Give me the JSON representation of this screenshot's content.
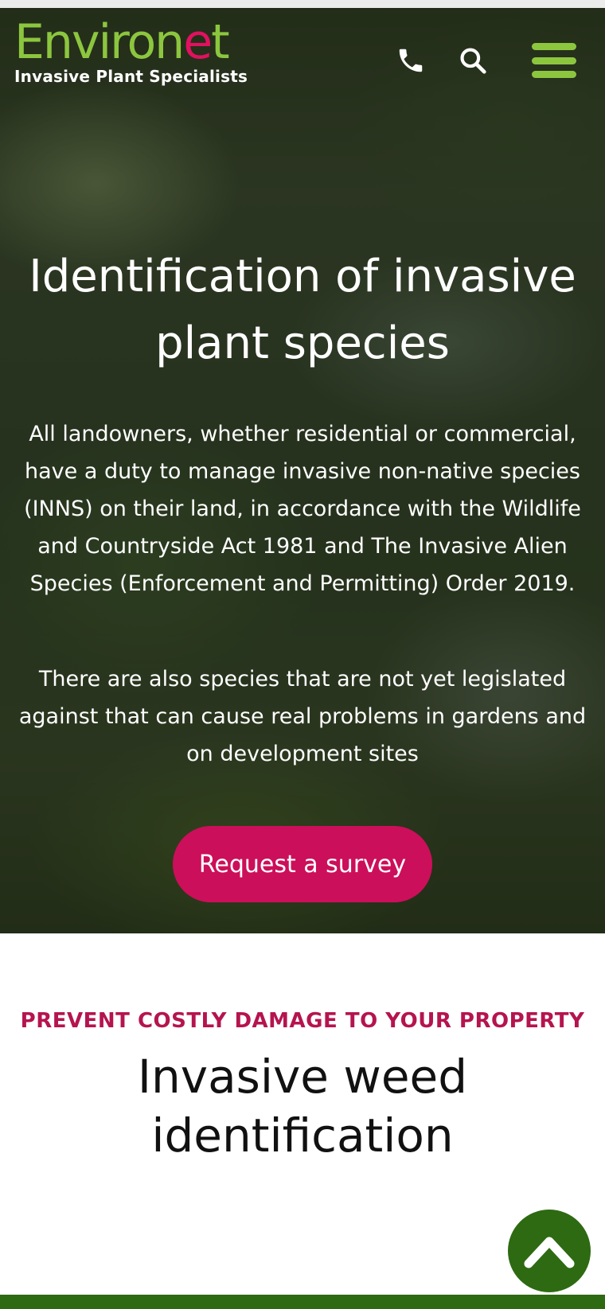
{
  "header": {
    "logo_word_start": "Environ",
    "logo_word_mark": "e",
    "logo_word_end": "t",
    "logo_tagline": "Invasive Plant Specialists",
    "icons": {
      "phone": "phone-icon",
      "search": "search-icon",
      "menu": "hamburger-menu-icon"
    }
  },
  "hero": {
    "title": "Identification of invasive plant species",
    "paragraph_1": "All landowners, whether residential or commercial, have a duty to manage invasive non-native species (INNS) on their land, in accordance with the Wildlife and Countryside Act 1981 and The Invasive Alien Species (Enforcement and Permitting) Order 2019.",
    "paragraph_2": "There are also species that are not yet legislated against that can cause real problems in gardens and on development sites",
    "cta_label": "Request a survey"
  },
  "section": {
    "eyebrow": "PREVENT COSTLY DAMAGE TO YOUR PROPERTY",
    "title": "Invasive weed identification"
  },
  "scroll_to_top": {
    "icon": "chevron-up-icon"
  },
  "colors": {
    "brand_green": "#8cc63f",
    "brand_pink": "#cc0f5a",
    "eyebrow_pink": "#b5144f",
    "dark_green": "#2d6a12"
  }
}
